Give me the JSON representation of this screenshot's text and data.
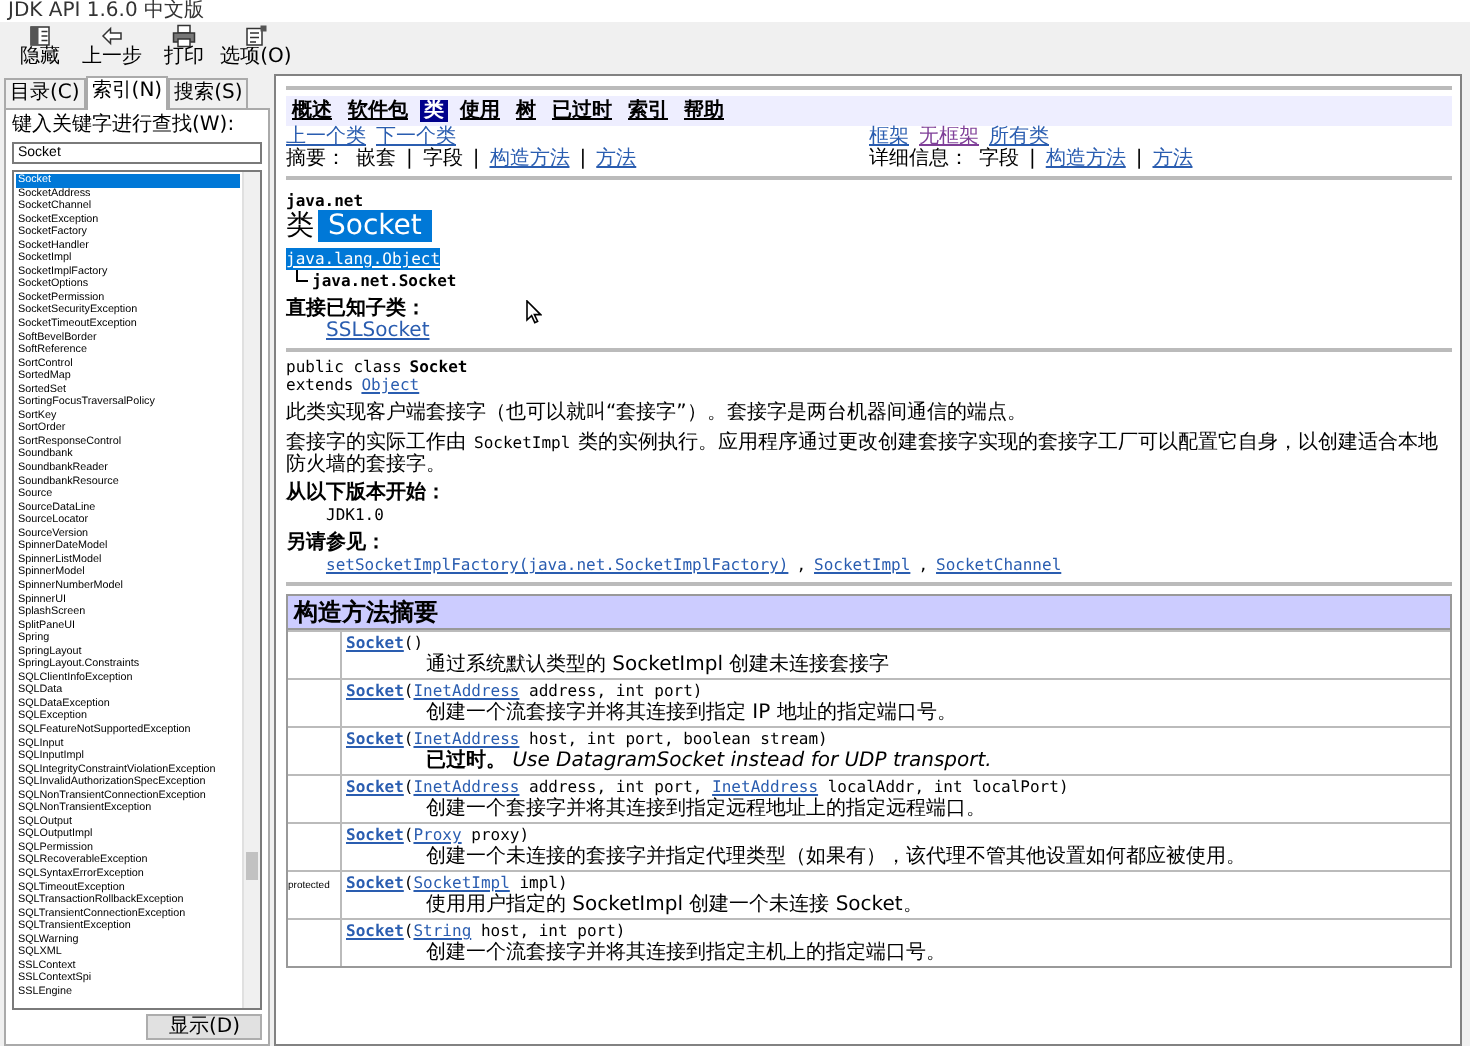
{
  "window": {
    "title": "JDK API 1.6.0 中文版"
  },
  "toolbar": [
    {
      "label": "隐藏"
    },
    {
      "label": "上一步"
    },
    {
      "label": "打印"
    },
    {
      "label": "选项(O)"
    }
  ],
  "nav_tabs": [
    {
      "label": "目录(C)",
      "selected": false
    },
    {
      "label": "索引(N)",
      "selected": true
    },
    {
      "label": "搜索(S)",
      "selected": false
    }
  ],
  "index_panel": {
    "label": "键入关键字进行查找(W):",
    "search": {
      "value": "Socket"
    },
    "items": [
      {
        "label": "Socket",
        "selected": true
      },
      {
        "label": "SocketAddress",
        "selected": false
      },
      {
        "label": "SocketChannel",
        "selected": false
      },
      {
        "label": "SocketException",
        "selected": false
      },
      {
        "label": "SocketFactory",
        "selected": false
      },
      {
        "label": "SocketHandler",
        "selected": false
      },
      {
        "label": "SocketImpl",
        "selected": false
      },
      {
        "label": "SocketImplFactory",
        "selected": false
      },
      {
        "label": "SocketOptions",
        "selected": false
      },
      {
        "label": "SocketPermission",
        "selected": false
      },
      {
        "label": "SocketSecurityException",
        "selected": false
      },
      {
        "label": "SocketTimeoutException",
        "selected": false
      },
      {
        "label": "SoftBevelBorder",
        "selected": false
      },
      {
        "label": "SoftReference",
        "selected": false
      },
      {
        "label": "SortControl",
        "selected": false
      },
      {
        "label": "SortedMap",
        "selected": false
      },
      {
        "label": "SortedSet",
        "selected": false
      },
      {
        "label": "SortingFocusTraversalPolicy",
        "selected": false
      },
      {
        "label": "SortKey",
        "selected": false
      },
      {
        "label": "SortOrder",
        "selected": false
      },
      {
        "label": "SortResponseControl",
        "selected": false
      },
      {
        "label": "Soundbank",
        "selected": false
      },
      {
        "label": "SoundbankReader",
        "selected": false
      },
      {
        "label": "SoundbankResource",
        "selected": false
      },
      {
        "label": "Source",
        "selected": false
      },
      {
        "label": "SourceDataLine",
        "selected": false
      },
      {
        "label": "SourceLocator",
        "selected": false
      },
      {
        "label": "SourceVersion",
        "selected": false
      },
      {
        "label": "SpinnerDateModel",
        "selected": false
      },
      {
        "label": "SpinnerListModel",
        "selected": false
      },
      {
        "label": "SpinnerModel",
        "selected": false
      },
      {
        "label": "SpinnerNumberModel",
        "selected": false
      },
      {
        "label": "SpinnerUI",
        "selected": false
      },
      {
        "label": "SplashScreen",
        "selected": false
      },
      {
        "label": "SplitPaneUI",
        "selected": false
      },
      {
        "label": "Spring",
        "selected": false
      },
      {
        "label": "SpringLayout",
        "selected": false
      },
      {
        "label": "SpringLayout.Constraints",
        "selected": false
      },
      {
        "label": "SQLClientInfoException",
        "selected": false
      },
      {
        "label": "SQLData",
        "selected": false
      },
      {
        "label": "SQLDataException",
        "selected": false
      },
      {
        "label": "SQLException",
        "selected": false
      },
      {
        "label": "SQLFeatureNotSupportedException",
        "selected": false
      },
      {
        "label": "SQLInput",
        "selected": false
      },
      {
        "label": "SQLInputImpl",
        "selected": false
      },
      {
        "label": "SQLIntegrityConstraintViolationException",
        "selected": false
      },
      {
        "label": "SQLInvalidAuthorizationSpecException",
        "selected": false
      },
      {
        "label": "SQLNonTransientConnectionException",
        "selected": false
      },
      {
        "label": "SQLNonTransientException",
        "selected": false
      },
      {
        "label": "SQLOutput",
        "selected": false
      },
      {
        "label": "SQLOutputImpl",
        "selected": false
      },
      {
        "label": "SQLPermission",
        "selected": false
      },
      {
        "label": "SQLRecoverableException",
        "selected": false
      },
      {
        "label": "SQLSyntaxErrorException",
        "selected": false
      },
      {
        "label": "SQLTimeoutException",
        "selected": false
      },
      {
        "label": "SQLTransactionRollbackException",
        "selected": false
      },
      {
        "label": "SQLTransientConnectionException",
        "selected": false
      },
      {
        "label": "SQLTransientException",
        "selected": false
      },
      {
        "label": "SQLWarning",
        "selected": false
      },
      {
        "label": "SQLXML",
        "selected": false
      },
      {
        "label": "SSLContext",
        "selected": false
      },
      {
        "label": "SSLContextSpi",
        "selected": false
      },
      {
        "label": "SSLEngine",
        "selected": false
      }
    ],
    "button": "显示(D)"
  },
  "doc": {
    "navbar": [
      {
        "label": "概述",
        "selected": false
      },
      {
        "label": "软件包",
        "selected": false
      },
      {
        "label": "类",
        "selected": true
      },
      {
        "label": "使用",
        "selected": false
      },
      {
        "label": "树",
        "selected": false
      },
      {
        "label": "已过时",
        "selected": false
      },
      {
        "label": "索引",
        "selected": false
      },
      {
        "label": "帮助",
        "selected": false
      }
    ],
    "prev_next": [
      "上一个类",
      "下一个类"
    ],
    "frames": [
      {
        "label": "框架",
        "visited": false
      },
      {
        "label": "无框架",
        "visited": true
      },
      {
        "label": "所有类",
        "visited": false
      }
    ],
    "summary": [
      {
        "kind": "plain",
        "text": "摘要："
      },
      {
        "kind": "plain",
        "text": "嵌套"
      },
      {
        "kind": "sep",
        "text": "|"
      },
      {
        "kind": "plain",
        "text": "字段"
      },
      {
        "kind": "sep",
        "text": "|"
      },
      {
        "kind": "link",
        "text": "构造方法"
      },
      {
        "kind": "sep",
        "text": "|"
      },
      {
        "kind": "link",
        "text": "方法"
      }
    ],
    "detail": [
      {
        "kind": "plain",
        "text": "详细信息："
      },
      {
        "kind": "plain",
        "text": "字段"
      },
      {
        "kind": "sep",
        "text": "|"
      },
      {
        "kind": "link",
        "text": "构造方法"
      },
      {
        "kind": "sep",
        "text": "|"
      },
      {
        "kind": "link",
        "text": "方法"
      }
    ],
    "package": "java.net",
    "class_label": "类",
    "class_name": "Socket",
    "hierarchy": [
      "java.lang.Object",
      "java.net.Socket"
    ],
    "subclasses_heading": "直接已知子类：",
    "subclasses": [
      "SSLSocket"
    ],
    "declaration": {
      "prefix": "public class",
      "name": "Socket",
      "extends_label": "extends",
      "extends": "Object"
    },
    "paragraphs": [
      [
        {
          "kind": "text",
          "text": "此类实现客户端套接字（也可以就叫“套接字”）。套接字是两台机器间通信的端点。"
        }
      ],
      [
        {
          "kind": "text",
          "text": "套接字的实际工作由"
        },
        {
          "kind": "code",
          "text": "SocketImpl"
        },
        {
          "kind": "text",
          "text": "类的实例执行。应用程序通过更改创建套接字实现的套接字工厂可以配置它自身，以创建适合本地防火墙的套接字。"
        }
      ]
    ],
    "since_heading": "从以下版本开始：",
    "since": "JDK1.0",
    "see_heading": "另请参见：",
    "see_also": [
      {
        "kind": "link",
        "text": "setSocketImplFactory(java.net.SocketImplFactory)"
      },
      {
        "kind": "plain",
        "text": ","
      },
      {
        "kind": "link",
        "text": "SocketImpl"
      },
      {
        "kind": "plain",
        "text": ","
      },
      {
        "kind": "link",
        "text": "SocketChannel"
      }
    ],
    "constructor_summary": {
      "title": "构造方法摘要",
      "rows": [
        {
          "segments": [
            {
              "kind": "name",
              "text": "Socket"
            },
            {
              "kind": "plain",
              "text": "()"
            }
          ],
          "description": "通过系统默认类型的 SocketImpl 创建未连接套接字"
        },
        {
          "segments": [
            {
              "kind": "name",
              "text": "Socket"
            },
            {
              "kind": "plain",
              "text": "("
            },
            {
              "kind": "link",
              "text": "InetAddress"
            },
            {
              "kind": "plain",
              "text": " address, int port)"
            }
          ],
          "description": "创建一个流套接字并将其连接到指定 IP 地址的指定端口号。"
        },
        {
          "segments": [
            {
              "kind": "name",
              "text": "Socket"
            },
            {
              "kind": "plain",
              "text": "("
            },
            {
              "kind": "link",
              "text": "InetAddress"
            },
            {
              "kind": "plain",
              "text": " host, int port, boolean stream)"
            }
          ],
          "description": "**已过时。** *Use DatagramSocket instead for UDP transport.*"
        },
        {
          "segments": [
            {
              "kind": "name",
              "text": "Socket"
            },
            {
              "kind": "plain",
              "text": "("
            },
            {
              "kind": "link",
              "text": "InetAddress"
            },
            {
              "kind": "plain",
              "text": " address, int port, "
            },
            {
              "kind": "link",
              "text": "InetAddress"
            },
            {
              "kind": "plain",
              "text": " localAddr, int localPort)"
            }
          ],
          "description": "创建一个套接字并将其连接到指定远程地址上的指定远程端口。"
        },
        {
          "segments": [
            {
              "kind": "name",
              "text": "Socket"
            },
            {
              "kind": "plain",
              "text": "("
            },
            {
              "kind": "link",
              "text": "Proxy"
            },
            {
              "kind": "plain",
              "text": " proxy)"
            }
          ],
          "description": "创建一个未连接的套接字并指定代理类型（如果有），该代理不管其他设置如何都应被使用。"
        },
        {
          "modifier": "protected",
          "segments": [
            {
              "kind": "name",
              "text": "Socket"
            },
            {
              "kind": "plain",
              "text": "("
            },
            {
              "kind": "link",
              "text": "SocketImpl"
            },
            {
              "kind": "plain",
              "text": " impl)"
            }
          ],
          "description": "使用用户指定的 SocketImpl 创建一个未连接 Socket。"
        },
        {
          "segments": [
            {
              "kind": "name",
              "text": "Socket"
            },
            {
              "kind": "plain",
              "text": "("
            },
            {
              "kind": "link",
              "text": "String"
            },
            {
              "kind": "plain",
              "text": " host, int port)"
            }
          ],
          "description": "创建一个流套接字并将其连接到指定主机上的指定端口号。"
        }
      ]
    }
  }
}
